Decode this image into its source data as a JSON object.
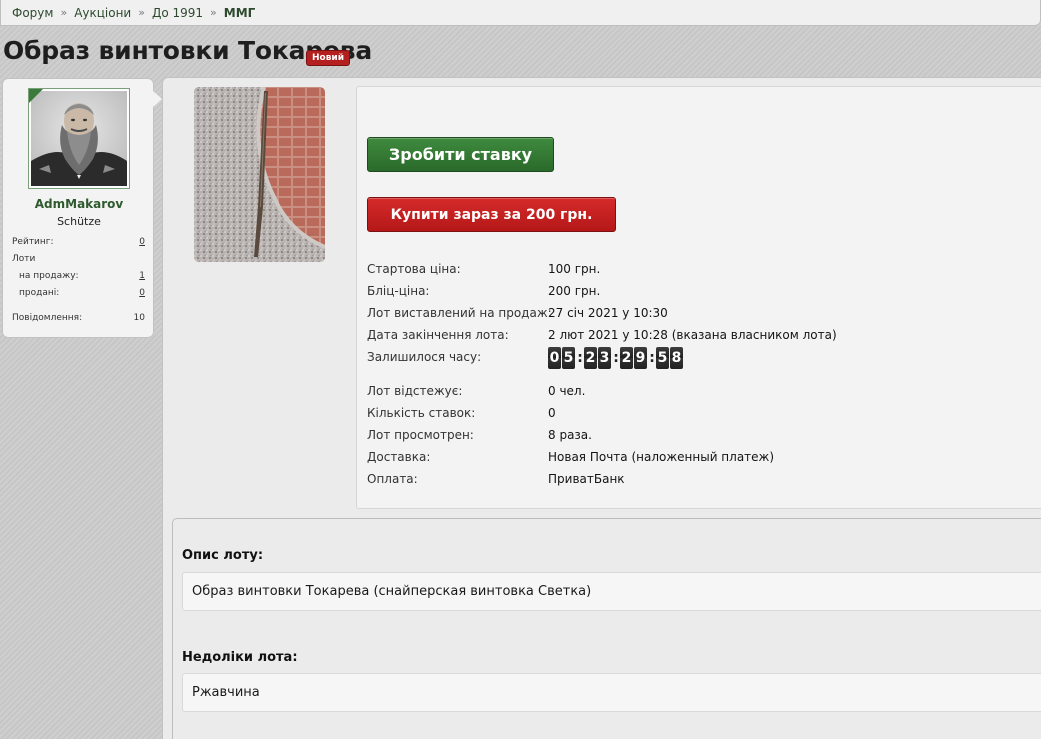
{
  "breadcrumb": {
    "items": [
      "Форум",
      "Аукціони",
      "До 1991"
    ],
    "current": "ММГ",
    "separator": "»"
  },
  "page": {
    "title": "Образ винтовки Токарева",
    "badge": "Новий"
  },
  "user": {
    "name": "AdmMakarov",
    "title": "Schütze",
    "stats": {
      "rating_label": "Рейтинг:",
      "rating_value": "0",
      "lots_label": "Лоти",
      "on_sale_label": "на продажу:",
      "on_sale_value": "1",
      "sold_label": "продані:",
      "sold_value": "0",
      "messages_label": "Повідомлення:",
      "messages_value": "10"
    }
  },
  "lot": {
    "bid_button": "Зробити ставку",
    "buy_button": "Купити зараз за 200 грн.",
    "fields": [
      {
        "label": "Стартова ціна:",
        "value": "100 грн."
      },
      {
        "label": "Бліц-ціна:",
        "value": "200 грн."
      },
      {
        "label": "Лот виставлений на продаж:",
        "value": "27 січ 2021 у 10:30"
      },
      {
        "label": "Дата закінчення лота:",
        "value": "2 лют 2021 у 10:28 (вказана власником лота)"
      }
    ],
    "time_left_label": "Залишилося часу:",
    "time_left_digits": [
      "0",
      "5",
      "2",
      "3",
      "2",
      "9",
      "5",
      "8"
    ],
    "fields2": [
      {
        "label": "Лот відстежує:",
        "value": "0 чел."
      },
      {
        "label": "Кількість ставок:",
        "value": "0"
      },
      {
        "label": "Лот просмотрен:",
        "value": "8 раза."
      },
      {
        "label": "Доставка:",
        "value": "Новая Почта (наложенный платеж)"
      },
      {
        "label": "Оплата:",
        "value": "ПриватБанк"
      }
    ]
  },
  "description": {
    "heading": "Опис лоту:",
    "text": "Образ винтовки Токарева (снайперская винтовка Светка)"
  },
  "defects": {
    "heading": "Недоліки лота:",
    "text": "Ржавчина"
  },
  "colors": {
    "brand_green": "#2e5a2e",
    "bid_button": "#2f7a2f",
    "buy_button": "#c42020",
    "badge": "#b42020"
  }
}
